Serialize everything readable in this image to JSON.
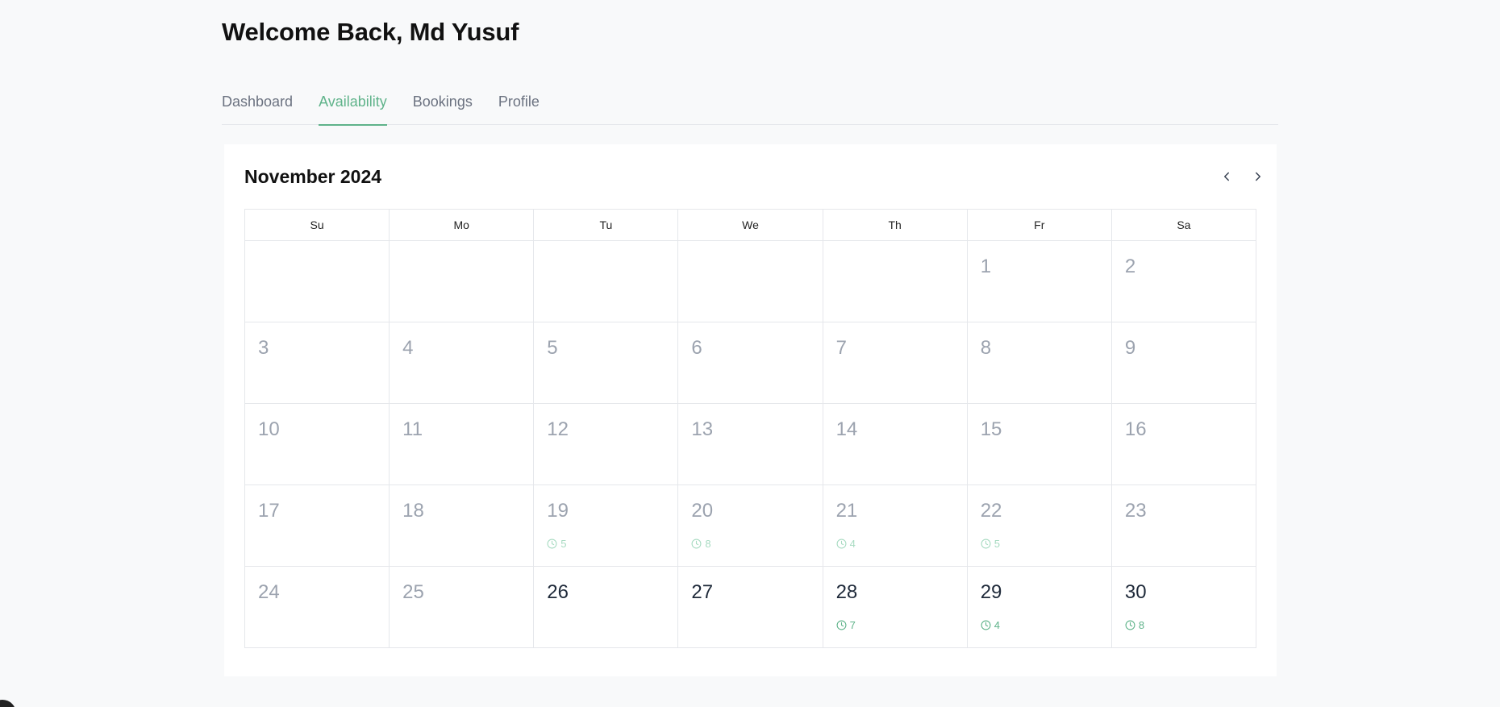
{
  "header": {
    "title": "Welcome Back, Md Yusuf"
  },
  "tabs": [
    {
      "label": "Dashboard",
      "active": false
    },
    {
      "label": "Availability",
      "active": true
    },
    {
      "label": "Bookings",
      "active": false
    },
    {
      "label": "Profile",
      "active": false
    }
  ],
  "calendar": {
    "month_label": "November 2024",
    "prev_icon": "chevron-left-icon",
    "next_icon": "chevron-right-icon",
    "weekdays": [
      "Su",
      "Mo",
      "Tu",
      "We",
      "Th",
      "Fr",
      "Sa"
    ],
    "weeks": [
      [
        {
          "day": ""
        },
        {
          "day": ""
        },
        {
          "day": ""
        },
        {
          "day": ""
        },
        {
          "day": ""
        },
        {
          "day": "1",
          "future": false,
          "slots": ""
        },
        {
          "day": "2",
          "future": false,
          "slots": ""
        }
      ],
      [
        {
          "day": "3",
          "future": false,
          "slots": ""
        },
        {
          "day": "4",
          "future": false,
          "slots": ""
        },
        {
          "day": "5",
          "future": false,
          "slots": ""
        },
        {
          "day": "6",
          "future": false,
          "slots": ""
        },
        {
          "day": "7",
          "future": false,
          "slots": ""
        },
        {
          "day": "8",
          "future": false,
          "slots": ""
        },
        {
          "day": "9",
          "future": false,
          "slots": ""
        }
      ],
      [
        {
          "day": "10",
          "future": false,
          "slots": ""
        },
        {
          "day": "11",
          "future": false,
          "slots": ""
        },
        {
          "day": "12",
          "future": false,
          "slots": ""
        },
        {
          "day": "13",
          "future": false,
          "slots": ""
        },
        {
          "day": "14",
          "future": false,
          "slots": ""
        },
        {
          "day": "15",
          "future": false,
          "slots": ""
        },
        {
          "day": "16",
          "future": false,
          "slots": ""
        }
      ],
      [
        {
          "day": "17",
          "future": false,
          "slots": ""
        },
        {
          "day": "18",
          "future": false,
          "slots": ""
        },
        {
          "day": "19",
          "future": false,
          "slots": "5"
        },
        {
          "day": "20",
          "future": false,
          "slots": "8"
        },
        {
          "day": "21",
          "future": false,
          "slots": "4"
        },
        {
          "day": "22",
          "future": false,
          "slots": "5"
        },
        {
          "day": "23",
          "future": false,
          "slots": ""
        }
      ],
      [
        {
          "day": "24",
          "future": false,
          "slots": ""
        },
        {
          "day": "25",
          "future": false,
          "slots": ""
        },
        {
          "day": "26",
          "future": true,
          "slots": ""
        },
        {
          "day": "27",
          "future": true,
          "slots": ""
        },
        {
          "day": "28",
          "future": true,
          "slots": "7"
        },
        {
          "day": "29",
          "future": true,
          "slots": "4"
        },
        {
          "day": "30",
          "future": true,
          "slots": "8"
        }
      ]
    ]
  },
  "colors": {
    "accent": "#5fb38a",
    "accent_faded": "#a8dbc2",
    "past_day": "#9ca3af",
    "future_day": "#1f2a3a",
    "border": "#e5e7eb",
    "background": "#f8f9fa"
  }
}
